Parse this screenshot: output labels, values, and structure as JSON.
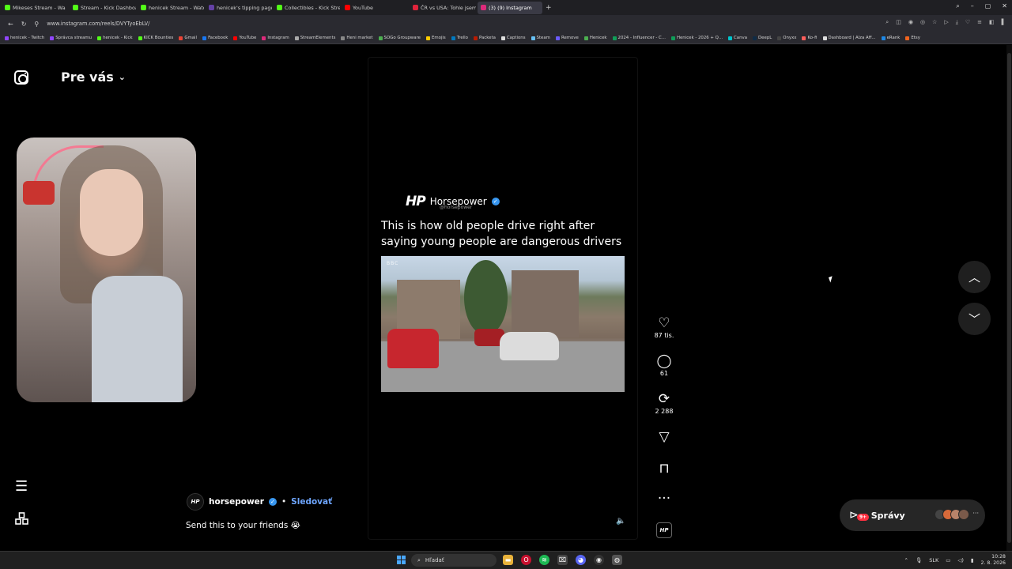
{
  "browser": {
    "tabs": [
      {
        "label": "Mikeses Stream - Wa",
        "color": "#53fc18"
      },
      {
        "label": "Stream - Kick Dashboard",
        "color": "#53fc18"
      },
      {
        "label": "henicek Stream - Watch L",
        "color": "#53fc18"
      },
      {
        "label": "henicek's tipping page",
        "color": "#6441a5"
      },
      {
        "label": "Collectibles - Kick Stream",
        "color": "#53fc18"
      },
      {
        "label": "YouTube",
        "color": "#ff0000"
      },
      {
        "label": "ČR vs USA: Tohle jsem v Č",
        "color": "#e0243b"
      },
      {
        "label": "(3) (9) Instagram",
        "color": "#dd2a7b",
        "active": true
      }
    ],
    "new_tab": "+",
    "url": "www.instagram.com/reels/DVYTyoEbLV/",
    "bookmarks": [
      {
        "label": "henicek - Twitch",
        "color": "#9146ff"
      },
      {
        "label": "Správca streamu",
        "color": "#9146ff"
      },
      {
        "label": "henicek - Kick",
        "color": "#53fc18"
      },
      {
        "label": "KICK Bounties",
        "color": "#53fc18"
      },
      {
        "label": "Gmail",
        "color": "#ea4335"
      },
      {
        "label": "Facebook",
        "color": "#1877f2"
      },
      {
        "label": "YouTube",
        "color": "#ff0000"
      },
      {
        "label": "Instagram",
        "color": "#dd2a7b"
      },
      {
        "label": "StreamElements",
        "color": "#aaaaaa"
      },
      {
        "label": "Heni market",
        "color": "#888888"
      },
      {
        "label": "SOGo Groupware",
        "color": "#4caf50"
      },
      {
        "label": "Emojis",
        "color": "#ffcc00"
      },
      {
        "label": "Trello",
        "color": "#0079bf"
      },
      {
        "label": "Packeta",
        "color": "#ba1b02"
      },
      {
        "label": "Captions",
        "color": "#dddddd"
      },
      {
        "label": "Steam",
        "color": "#66c0f4"
      },
      {
        "label": "Remove",
        "color": "#6b5bff"
      },
      {
        "label": "Henicek",
        "color": "#4caf50"
      },
      {
        "label": "2024 - Influencer - C...",
        "color": "#0f9d58"
      },
      {
        "label": "Henicek - 2026 + Q...",
        "color": "#0f9d58"
      },
      {
        "label": "Canva",
        "color": "#00c4cc"
      },
      {
        "label": "DeepL",
        "color": "#0f2b46"
      },
      {
        "label": "Onyxx",
        "color": "#444444"
      },
      {
        "label": "Ko-fi",
        "color": "#ff5e5b"
      },
      {
        "label": "Dashboard | Alza Aff...",
        "color": "#dddddd"
      },
      {
        "label": "eRank",
        "color": "#1e88e5"
      },
      {
        "label": "Etsy",
        "color": "#f1641e"
      }
    ]
  },
  "instagram": {
    "feed_title": "Pre vás",
    "reel": {
      "brand_mark": "HP",
      "account_name": "Horsepower",
      "account_handle": "@horsepower",
      "caption": "This is how old people drive right after saying young people are dangerous drivers",
      "video_watermark": "BBC"
    },
    "author": {
      "username": "horsepower",
      "separator": "•",
      "follow_label": "Sledovať",
      "description": "Send this to your friends 😭"
    },
    "actions": {
      "likes": "87 tis.",
      "comments": "61",
      "reposts": "2 288"
    },
    "messages": {
      "label": "Správy",
      "badge": "9+"
    }
  },
  "taskbar": {
    "search_placeholder": "Hľadať",
    "lang": "SLK",
    "time": "10:28",
    "date": "2. 8. 2026"
  },
  "colors": {
    "accent_link": "#6ea6ff",
    "verified": "#3897f0",
    "badge": "#ff3040"
  }
}
